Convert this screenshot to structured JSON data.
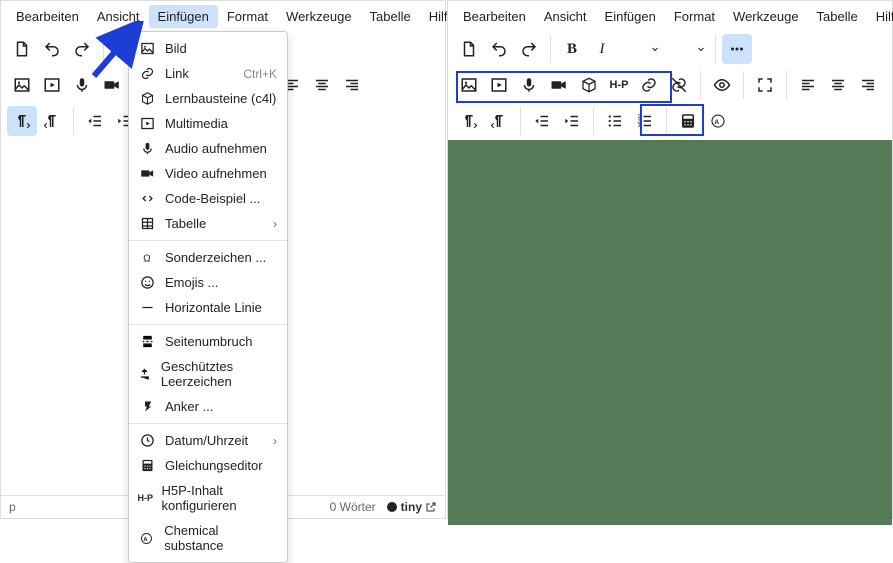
{
  "menubar": {
    "items": [
      "Bearbeiten",
      "Ansicht",
      "Einfügen",
      "Format",
      "Werkzeuge",
      "Tabelle",
      "Hilfe"
    ],
    "active_index_left": 2
  },
  "dropdown": {
    "items": [
      {
        "icon": "image-icon",
        "label": "Bild"
      },
      {
        "icon": "link-icon",
        "label": "Link",
        "shortcut": "Ctrl+K"
      },
      {
        "icon": "cube-icon",
        "label": "Lernbausteine (c4l)"
      },
      {
        "icon": "play-icon",
        "label": "Multimedia"
      },
      {
        "icon": "mic-icon",
        "label": "Audio aufnehmen"
      },
      {
        "icon": "videocam-icon",
        "label": "Video aufnehmen"
      },
      {
        "icon": "code-icon",
        "label": "Code-Beispiel ..."
      },
      {
        "icon": "table-icon",
        "label": "Tabelle",
        "submenu": true
      },
      {
        "sep": true
      },
      {
        "icon": "omega-icon",
        "label": "Sonderzeichen ..."
      },
      {
        "icon": "emoji-icon",
        "label": "Emojis ..."
      },
      {
        "icon": "hr-icon",
        "label": "Horizontale Linie"
      },
      {
        "sep": true
      },
      {
        "icon": "pagebreak-icon",
        "label": "Seitenumbruch"
      },
      {
        "icon": "nbsp-icon",
        "label": "Geschütztes Leerzeichen"
      },
      {
        "icon": "anchor-icon",
        "label": "Anker ..."
      },
      {
        "sep": true
      },
      {
        "icon": "clock-icon",
        "label": "Datum/Uhrzeit",
        "submenu": true
      },
      {
        "icon": "calc-icon",
        "label": "Gleichungseditor"
      },
      {
        "icon": "h5p-icon",
        "label": "H5P-Inhalt konfigurieren"
      },
      {
        "icon": "chem-icon",
        "label": "Chemical substance"
      }
    ]
  },
  "status": {
    "path": "p",
    "words": "0 Wörter",
    "brand": "tiny"
  },
  "toolbar_row1_left": [
    {
      "name": "document-icon",
      "glyph": "doc"
    },
    {
      "name": "undo-icon",
      "glyph": "undo"
    },
    {
      "name": "redo-icon",
      "glyph": "redo"
    }
  ],
  "toolbar_row1_right_typeset": [
    {
      "name": "bold-icon",
      "glyph": "bold"
    },
    {
      "name": "italic-icon",
      "glyph": "italic"
    },
    {
      "name": "textcolor-icon",
      "glyph": "textcolor"
    },
    {
      "name": "chevron-down-icon",
      "glyph": "chev"
    },
    {
      "name": "highlight-icon",
      "glyph": "highlight"
    },
    {
      "name": "chevron-down-icon",
      "glyph": "chev"
    }
  ],
  "toolbar_align": [
    {
      "name": "align-left-icon",
      "glyph": "aleft"
    },
    {
      "name": "align-center-icon",
      "glyph": "acenter"
    },
    {
      "name": "align-right-icon",
      "glyph": "aright"
    }
  ],
  "toolbar_row2_media": [
    {
      "name": "image-icon",
      "glyph": "image"
    },
    {
      "name": "media-play-icon",
      "glyph": "mplay"
    },
    {
      "name": "mic-icon",
      "glyph": "mic"
    },
    {
      "name": "videocam-icon",
      "glyph": "vcam"
    },
    {
      "name": "package-icon",
      "glyph": "pkg"
    }
  ],
  "toolbar_row2_extra": [
    {
      "name": "h5p-icon",
      "glyph": "h5p"
    },
    {
      "name": "link-icon",
      "glyph": "link"
    },
    {
      "name": "unlink-icon",
      "glyph": "unlink"
    }
  ],
  "toolbar_row2_view": [
    {
      "name": "preview-icon",
      "glyph": "eye"
    },
    {
      "name": "fullscreen-icon",
      "glyph": "full"
    }
  ],
  "toolbar_row3_para": [
    {
      "name": "ltr-icon",
      "glyph": "ltr",
      "active": true
    },
    {
      "name": "rtl-icon",
      "glyph": "rtl"
    }
  ],
  "toolbar_row3_indent": [
    {
      "name": "outdent-icon",
      "glyph": "outdent"
    },
    {
      "name": "indent-icon",
      "glyph": "indent"
    }
  ],
  "toolbar_row3_list": [
    {
      "name": "bullet-list-icon",
      "glyph": "ul"
    },
    {
      "name": "number-list-icon",
      "glyph": "ol"
    }
  ],
  "toolbar_row3_tools": [
    {
      "name": "equation-icon",
      "glyph": "calc"
    },
    {
      "name": "chem-icon",
      "glyph": "chem"
    }
  ]
}
